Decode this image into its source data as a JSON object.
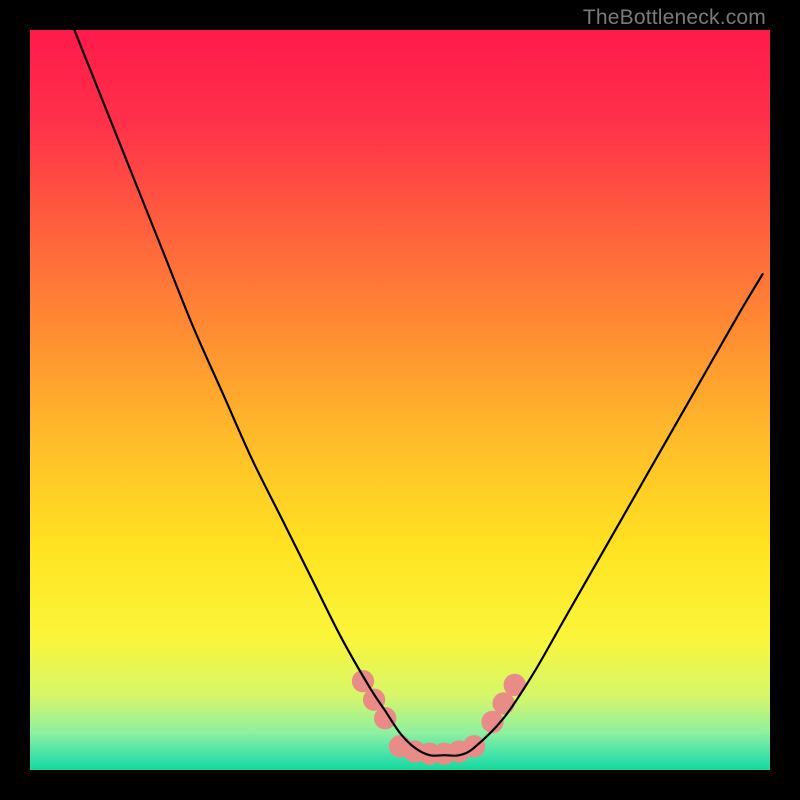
{
  "watermark": "TheBottleneck.com",
  "gradient": {
    "stops": [
      {
        "offset": 0.0,
        "color": "#ff1a4b"
      },
      {
        "offset": 0.12,
        "color": "#ff2f4a"
      },
      {
        "offset": 0.25,
        "color": "#ff5a3f"
      },
      {
        "offset": 0.4,
        "color": "#ff8a33"
      },
      {
        "offset": 0.55,
        "color": "#ffbb2a"
      },
      {
        "offset": 0.7,
        "color": "#ffe321"
      },
      {
        "offset": 0.82,
        "color": "#fbf53a"
      },
      {
        "offset": 0.9,
        "color": "#d6f66a"
      },
      {
        "offset": 0.95,
        "color": "#8ef0a0"
      },
      {
        "offset": 0.985,
        "color": "#35e0a8"
      },
      {
        "offset": 1.0,
        "color": "#16d99b"
      }
    ]
  },
  "chart_data": {
    "type": "line",
    "title": "",
    "xlabel": "",
    "ylabel": "",
    "xlim": [
      0,
      100
    ],
    "ylim": [
      0,
      100
    ],
    "grid": false,
    "description": "V-shaped bottleneck curve with flat minimum near center; y=100 is maximum bottleneck (red), y=0 is balanced (green). Background is a vertical red→yellow→green gradient.",
    "series": [
      {
        "name": "bottleneck-curve",
        "color": "#000000",
        "x": [
          6,
          10,
          14,
          18,
          22,
          26,
          30,
          34,
          38,
          42,
          46,
          48,
          50,
          52,
          54,
          56,
          58,
          60,
          64,
          68,
          72,
          76,
          80,
          84,
          88,
          92,
          96,
          99
        ],
        "y": [
          100,
          90,
          80,
          70,
          60,
          51,
          42,
          34,
          26,
          18,
          11,
          8,
          5,
          3,
          2,
          2,
          2,
          3,
          7,
          13,
          20,
          27,
          34,
          41,
          48,
          55,
          62,
          67
        ]
      }
    ],
    "markers": [
      {
        "name": "left-cluster-1",
        "x": 45.0,
        "y": 12.0,
        "r": 1.0,
        "color": "#e98b86"
      },
      {
        "name": "left-cluster-2",
        "x": 46.5,
        "y": 9.5,
        "r": 1.0,
        "color": "#e98b86"
      },
      {
        "name": "left-cluster-3",
        "x": 48.0,
        "y": 7.0,
        "r": 1.0,
        "color": "#e98b86"
      },
      {
        "name": "flat-1",
        "x": 50.0,
        "y": 3.2,
        "r": 1.0,
        "color": "#e98b86"
      },
      {
        "name": "flat-2",
        "x": 52.0,
        "y": 2.5,
        "r": 1.0,
        "color": "#e98b86"
      },
      {
        "name": "flat-3",
        "x": 54.0,
        "y": 2.2,
        "r": 1.0,
        "color": "#e98b86"
      },
      {
        "name": "flat-4",
        "x": 56.0,
        "y": 2.2,
        "r": 1.0,
        "color": "#e98b86"
      },
      {
        "name": "flat-5",
        "x": 58.0,
        "y": 2.5,
        "r": 1.0,
        "color": "#e98b86"
      },
      {
        "name": "flat-6",
        "x": 60.0,
        "y": 3.2,
        "r": 1.0,
        "color": "#e98b86"
      },
      {
        "name": "right-cluster-1",
        "x": 62.5,
        "y": 6.5,
        "r": 1.0,
        "color": "#e98b86"
      },
      {
        "name": "right-cluster-2",
        "x": 64.0,
        "y": 9.0,
        "r": 1.0,
        "color": "#e98b86"
      },
      {
        "name": "right-cluster-3",
        "x": 65.5,
        "y": 11.5,
        "r": 1.0,
        "color": "#e98b86"
      }
    ]
  }
}
